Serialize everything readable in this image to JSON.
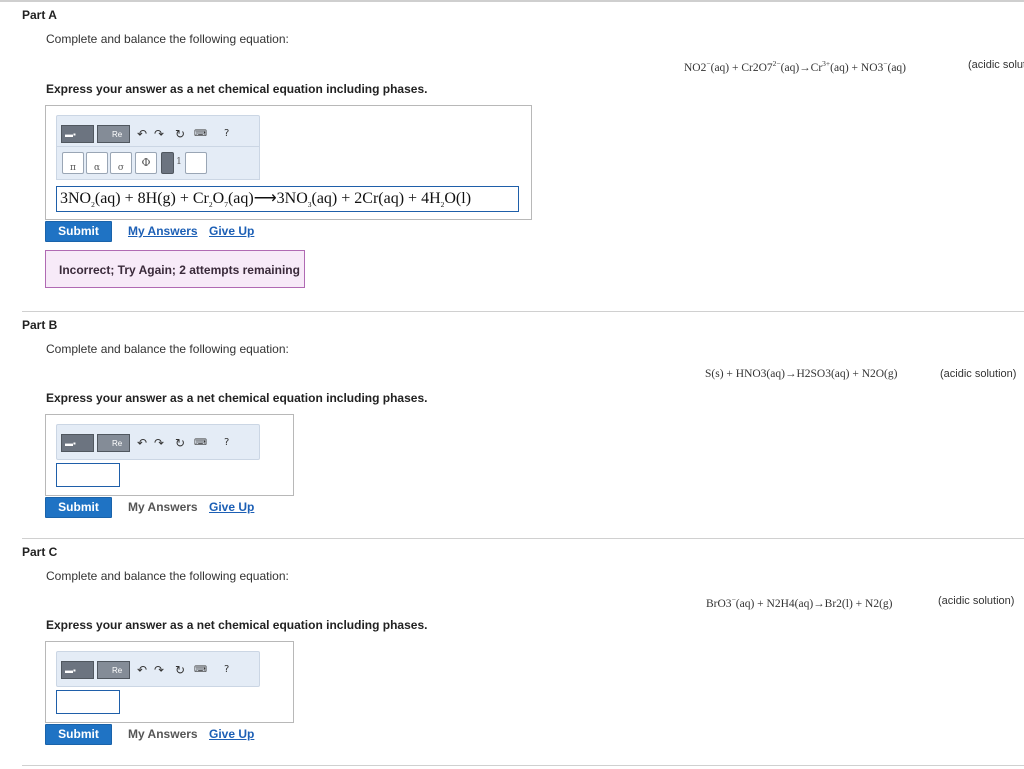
{
  "partA": {
    "title": "Part A",
    "prompt": "Complete and balance the following equation:",
    "equation_html": "NO2<sup>−</sup>(aq) + Cr2O7<sup>2−</sup>(aq)→Cr<sup>3+</sup>(aq) + NO3<sup>−</sup>(aq)",
    "note": "(acidic solut",
    "instruction": "Express your answer as a net chemical equation including phases.",
    "answer_html": "3NO<sub>2</sub>(aq) + 8H(g) + Cr<sub>2</sub>O<sub>7</sub>(aq)⟶3NO<sub>3</sub>(aq) + 2Cr(aq) + 4H<sub>2</sub>O(l)",
    "submit_label": "Submit",
    "my_answers_label": "My Answers",
    "give_up_label": "Give Up",
    "feedback": "Incorrect; Try Again; 2 attempts remaining"
  },
  "partB": {
    "title": "Part B",
    "prompt": "Complete and balance the following equation:",
    "equation_html": "S(s) + HNO3(aq)→H2SO3(aq) + N2O(g)",
    "note": "(acidic solution)",
    "instruction": "Express your answer as a net chemical equation including phases.",
    "submit_label": "Submit",
    "my_answers_label": "My Answers",
    "give_up_label": "Give Up"
  },
  "partC": {
    "title": "Part C",
    "prompt": "Complete and balance the following equation:",
    "equation_html": "BrO3<sup>−</sup>(aq) + N2H4(aq)→Br2(l) + N2(g)",
    "note": "(acidic solution)",
    "instruction": "Express your answer as a net chemical equation including phases.",
    "submit_label": "Submit",
    "my_answers_label": "My Answers",
    "give_up_label": "Give Up"
  },
  "toolbar": {
    "template_label": "Re",
    "undo_icon": "undo-icon",
    "redo_icon": "redo-icon",
    "reset_icon": "reset-icon",
    "keyboard_icon": "keyboard-icon",
    "help_label": "?",
    "mini_phi": "Φ",
    "mini_one": "1"
  },
  "colors": {
    "submit_bg": "#1f73c4",
    "link": "#1c5fb5",
    "feedback_border": "#b06ab3",
    "feedback_bg": "#f7eaf8",
    "answer_border": "#1f5fa9"
  }
}
